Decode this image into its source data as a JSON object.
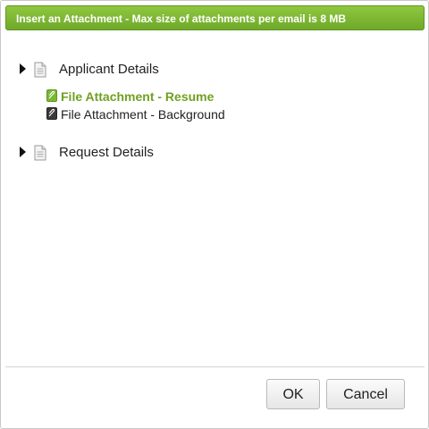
{
  "dialog": {
    "title": "Insert an Attachment - Max size of attachments per email is 8 MB"
  },
  "tree": {
    "nodes": [
      {
        "label": "Applicant Details",
        "icon": "document-icon",
        "children": [
          {
            "label": "File Attachment - Resume",
            "icon": "attachment-icon",
            "selected": true
          },
          {
            "label": "File Attachment - Background",
            "icon": "attachment-icon",
            "selected": false
          }
        ]
      },
      {
        "label": "Request Details",
        "icon": "document-icon",
        "children": []
      }
    ]
  },
  "buttons": {
    "ok": "OK",
    "cancel": "Cancel"
  },
  "colors": {
    "title_bar": "#7ab833",
    "selected_text": "#6fa122"
  }
}
